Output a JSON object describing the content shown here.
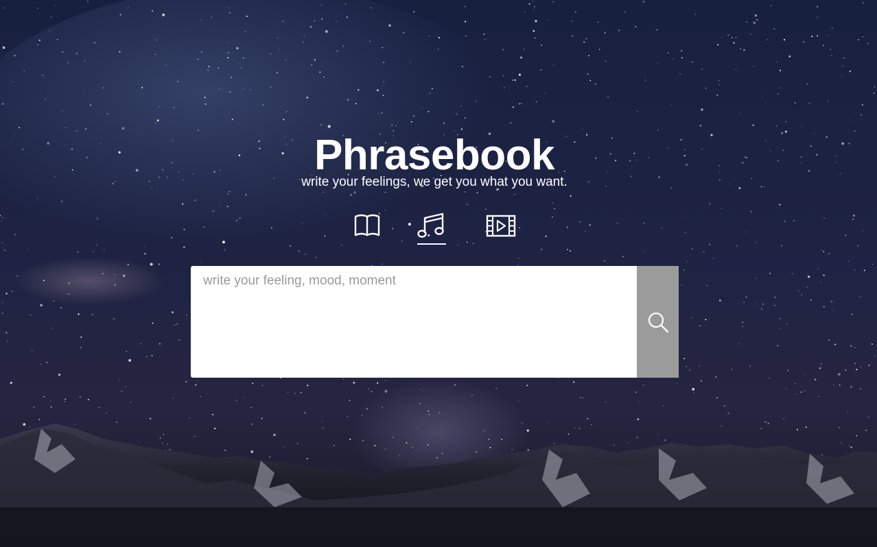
{
  "header": {
    "title": "Phrasebook",
    "subtitle": "write your feelings, we get you what you want."
  },
  "tabs": [
    {
      "name": "books",
      "icon": "open-book-icon",
      "active": false
    },
    {
      "name": "music",
      "icon": "music-note-icon",
      "active": true
    },
    {
      "name": "movies",
      "icon": "film-strip-icon",
      "active": false
    }
  ],
  "search": {
    "placeholder": "write your feeling, mood, moment",
    "value": "",
    "button_icon": "search-icon"
  },
  "colors": {
    "text": "#ffffff",
    "search_button": "#9b9b9b",
    "placeholder": "#9a9a9a",
    "sky": "#1b1f3d"
  }
}
